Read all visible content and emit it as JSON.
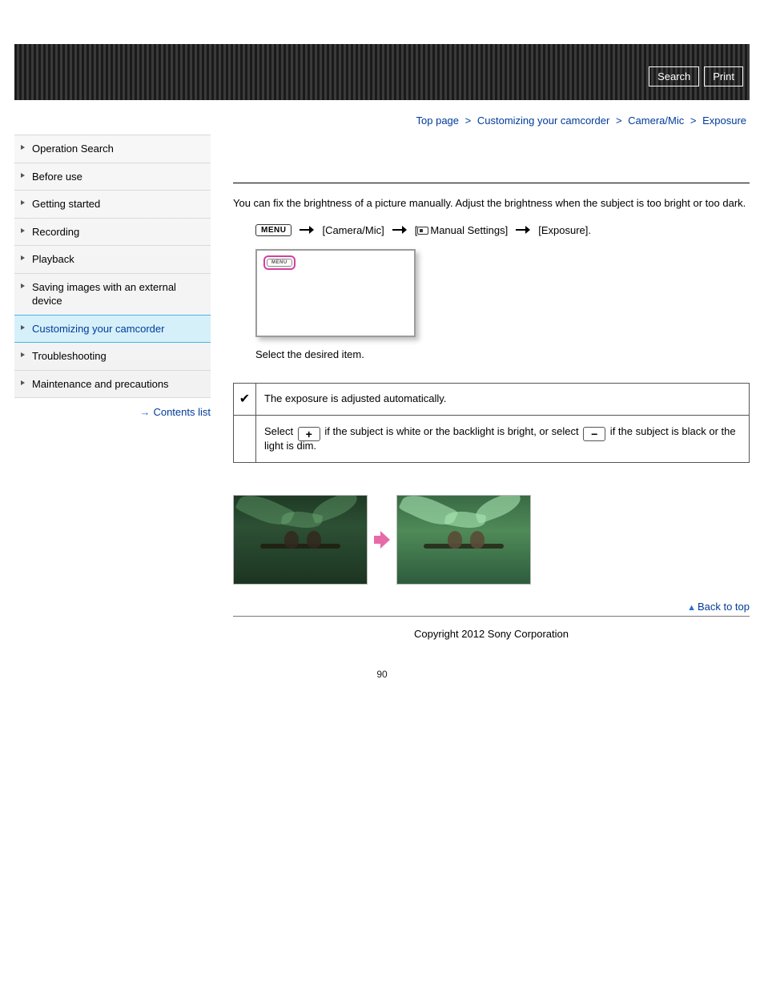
{
  "header": {
    "search_label": "Search",
    "print_label": "Print"
  },
  "breadcrumb": {
    "items": [
      "Top page",
      "Customizing your camcorder",
      "Camera/Mic",
      "Exposure"
    ],
    "sep": ">"
  },
  "sidebar": {
    "items": [
      {
        "label": "Operation Search"
      },
      {
        "label": "Before use"
      },
      {
        "label": "Getting started"
      },
      {
        "label": "Recording"
      },
      {
        "label": "Playback"
      },
      {
        "label": "Saving images with an external device"
      },
      {
        "label": "Customizing your camcorder"
      },
      {
        "label": "Troubleshooting"
      },
      {
        "label": "Maintenance and precautions"
      }
    ],
    "active_index": 6,
    "contents_list_label": "Contents list"
  },
  "main": {
    "intro": "You can fix the brightness of a picture manually. Adjust the brightness when the subject is too bright or too dark.",
    "nav_path": {
      "menu_chip": "MENU",
      "step1": "[Camera/Mic]",
      "step2_prefix": "[",
      "step2_text": "Manual Settings]",
      "step3": "[Exposure]."
    },
    "lcd_menu_label": "MENU",
    "caption": "Select the desired item.",
    "table": {
      "row1_text": "The exposure is adjusted automatically.",
      "row2_pre": "Select ",
      "row2_mid": " if the subject is white or the backlight is bright, or select ",
      "row2_post": " if the subject is black or the light is dim.",
      "plus": "+",
      "minus": "−"
    },
    "back_to_top": "Back to top",
    "copyright": "Copyright 2012 Sony Corporation"
  },
  "page_number": "90"
}
